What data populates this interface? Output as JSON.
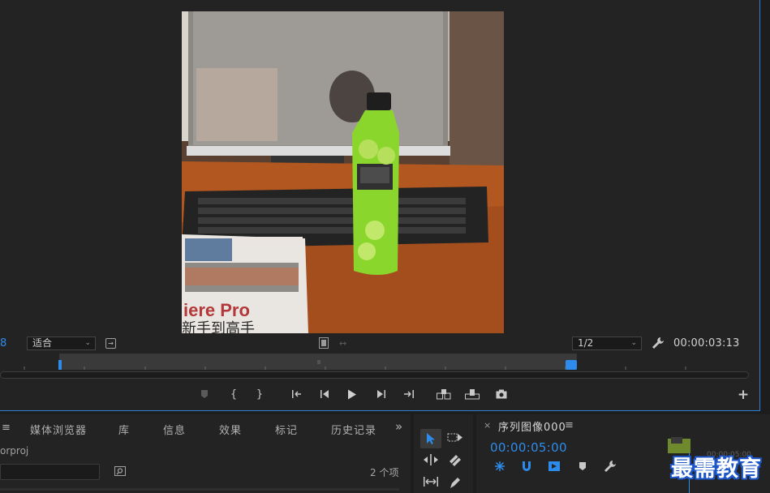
{
  "monitor": {
    "frame_fragment": "8",
    "fit_select": {
      "value": "适合"
    },
    "resolution_select": {
      "value": "1/2"
    },
    "timecode": "00:00:03:13",
    "viewer_image_text": "iere Pro",
    "viewer_image_text2": "新手到高手"
  },
  "transport": {
    "buttons": [
      "add-marker",
      "mark-in",
      "mark-out",
      "go-to-in",
      "step-back",
      "play",
      "step-forward",
      "go-to-out",
      "insert",
      "overwrite",
      "export-frame"
    ],
    "add_button": "+"
  },
  "project_panel": {
    "menu_glyph": "≡",
    "tabs": [
      "媒体浏览器",
      "库",
      "信息",
      "效果",
      "标记",
      "历史记录"
    ],
    "overflow": "»",
    "project_name": "orproj",
    "item_count": "2 个项"
  },
  "sequence_panel": {
    "close": "×",
    "title": "序列图像000",
    "menu_glyph": "≡",
    "timecode": "00:00:05:00",
    "mini_time": "00:00:05:00"
  },
  "watermark": "最需教育",
  "colors": {
    "accent_blue": "#2d8ceb",
    "panel_bg": "#232323",
    "app_bg": "#1d1d1d"
  }
}
